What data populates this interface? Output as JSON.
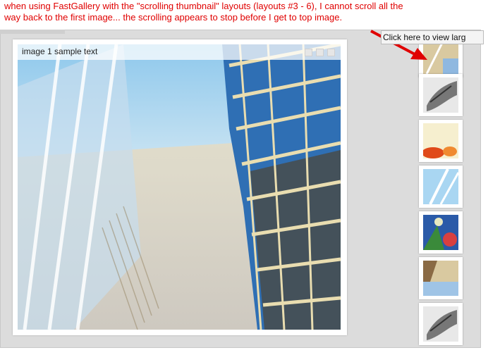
{
  "note": {
    "line1": "when using FastGallery with the \"scrolling thumbnail\" layouts (layouts #3 - 6), I cannot scroll all the",
    "line2": "way back to the first image... the scrolling appears to stop before I get to top image."
  },
  "main_image": {
    "caption": "image 1 sample text",
    "icons": [
      "zoom-icon",
      "fit-icon",
      "close-icon"
    ]
  },
  "tooltip": "Click here to view larg",
  "thumbnails": [
    {
      "name": "thumbnail-1",
      "icon": "tan-building-thumb"
    },
    {
      "name": "thumbnail-2",
      "icon": "gray-sketch-thumb"
    },
    {
      "name": "thumbnail-3",
      "icon": "cream-red-thumb"
    },
    {
      "name": "thumbnail-4",
      "icon": "blue-glass-thumb"
    },
    {
      "name": "thumbnail-5",
      "icon": "flower-sky-thumb"
    },
    {
      "name": "thumbnail-6",
      "icon": "tan-building-thumb"
    },
    {
      "name": "thumbnail-7",
      "icon": "gray-sketch-thumb"
    }
  ],
  "colors": {
    "note_text": "#e00000",
    "arrow": "#e00000",
    "frame_bg": "#dcdcdc"
  }
}
